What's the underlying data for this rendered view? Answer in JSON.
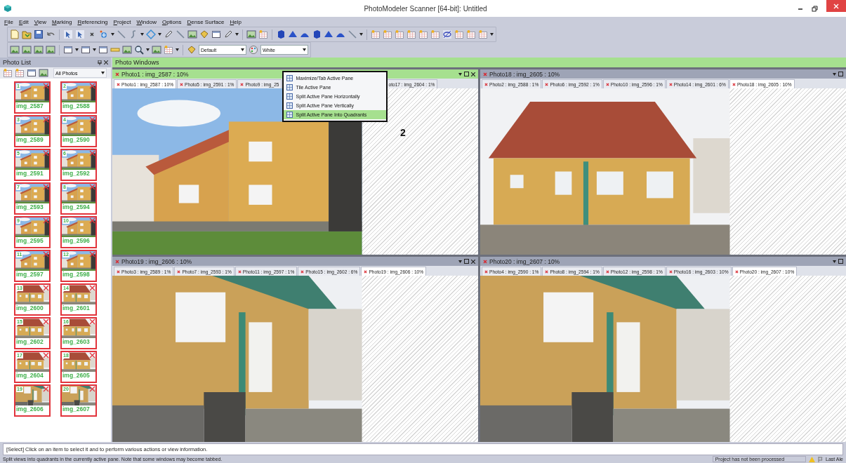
{
  "window": {
    "title": "PhotoModeler Scanner [64-bit]: Untitled"
  },
  "menu": [
    "File",
    "Edit",
    "View",
    "Marking",
    "Referencing",
    "Project",
    "Window",
    "Options",
    "Dense Surface",
    "Help"
  ],
  "toolbar": {
    "dropdowns": [
      {
        "value": "Default"
      },
      {
        "value": "White"
      }
    ]
  },
  "photo_list": {
    "title": "Photo List",
    "filter": "All Photos",
    "photos": [
      {
        "number": "1",
        "name": "img_2587"
      },
      {
        "number": "2",
        "name": "img_2588"
      },
      {
        "number": "3",
        "name": "img_2589"
      },
      {
        "number": "4",
        "name": "img_2590"
      },
      {
        "number": "5",
        "name": "img_2591"
      },
      {
        "number": "6",
        "name": "img_2592"
      },
      {
        "number": "7",
        "name": "img_2593"
      },
      {
        "number": "8",
        "name": "img_2594"
      },
      {
        "number": "9",
        "name": "img_2595"
      },
      {
        "number": "10",
        "name": "img_2596"
      },
      {
        "number": "11",
        "name": "img_2597"
      },
      {
        "number": "12",
        "name": "img_2598"
      },
      {
        "number": "13",
        "name": "img_2600"
      },
      {
        "number": "14",
        "name": "img_2601"
      },
      {
        "number": "15",
        "name": "img_2602"
      },
      {
        "number": "16",
        "name": "img_2603"
      },
      {
        "number": "17",
        "name": "img_2604"
      },
      {
        "number": "18",
        "name": "img_2605"
      },
      {
        "number": "19",
        "name": "img_2606"
      },
      {
        "number": "20",
        "name": "img_2607"
      }
    ]
  },
  "photo_windows": {
    "title": "Photo Windows",
    "panes": [
      {
        "title": "Photo1 : img_2587 : 10%",
        "active": true,
        "closable": true,
        "marker": "2",
        "tabs": [
          {
            "label": "Photo1 : img_2587 : 10%",
            "selected": true,
            "closable": true
          },
          {
            "label": "Photo5 : img_2591 : 1%",
            "selected": false,
            "closable": true
          },
          {
            "label": "Photo9 : img_25",
            "selected": false,
            "closable": true
          },
          {
            "label": "oto17 : img_2604 : 1%",
            "selected": false,
            "closable": false
          }
        ],
        "menu": [
          {
            "label": "Maximize/Tab Active Pane",
            "selected": false
          },
          {
            "label": "Tile Active Pane",
            "selected": false
          },
          {
            "label": "Split Active Pane Horizontally",
            "selected": false
          },
          {
            "label": "Split Active Pane Vertically",
            "selected": false
          },
          {
            "label": "Split Active Pane Into Quadrants",
            "selected": true
          }
        ]
      },
      {
        "title": "Photo18 : img_2605 : 10%",
        "active": false,
        "closable": false,
        "tabs": [
          {
            "label": "Photo2 : img_2588 : 1%",
            "selected": false,
            "closable": true
          },
          {
            "label": "Photo6 : img_2592 : 1%",
            "selected": false,
            "closable": true
          },
          {
            "label": "Photo10 : img_2596 : 1%",
            "selected": false,
            "closable": true
          },
          {
            "label": "Photo14 : img_2601 : 6%",
            "selected": false,
            "closable": true
          },
          {
            "label": "Photo18 : img_2605 : 10%",
            "selected": true,
            "closable": true
          }
        ]
      },
      {
        "title": "Photo19 : img_2606 : 10%",
        "active": false,
        "closable": true,
        "tabs": [
          {
            "label": "Photo3 : img_2589 : 1%",
            "selected": false,
            "closable": true
          },
          {
            "label": "Photo7 : img_2593 : 1%",
            "selected": false,
            "closable": true
          },
          {
            "label": "Photo11 : img_2597 : 1%",
            "selected": false,
            "closable": true
          },
          {
            "label": "Photo15 : img_2602 : 6%",
            "selected": false,
            "closable": true
          },
          {
            "label": "Photo19 : img_2606 : 10%",
            "selected": true,
            "closable": true
          }
        ]
      },
      {
        "title": "Photo20 : img_2607 : 10%",
        "active": false,
        "closable": false,
        "tabs": [
          {
            "label": "Photo4 : img_2590 : 1%",
            "selected": false,
            "closable": true
          },
          {
            "label": "Photo8 : img_2594 : 1%",
            "selected": false,
            "closable": true
          },
          {
            "label": "Photo12 : img_2598 : 1%",
            "selected": false,
            "closable": true
          },
          {
            "label": "Photo16 : img_2603 : 10%",
            "selected": false,
            "closable": true
          },
          {
            "label": "Photo20 : img_2607 : 10%",
            "selected": true,
            "closable": true
          }
        ]
      }
    ]
  },
  "command_line": "[Select] Click on an item to select it and to perform various actions or view information.",
  "status_bar": {
    "message": "Split views into quadrants in the currently active pane. Note that some windows may become tabbed.",
    "project_state": "Project has not been processed",
    "alerts": "Last Ale"
  }
}
